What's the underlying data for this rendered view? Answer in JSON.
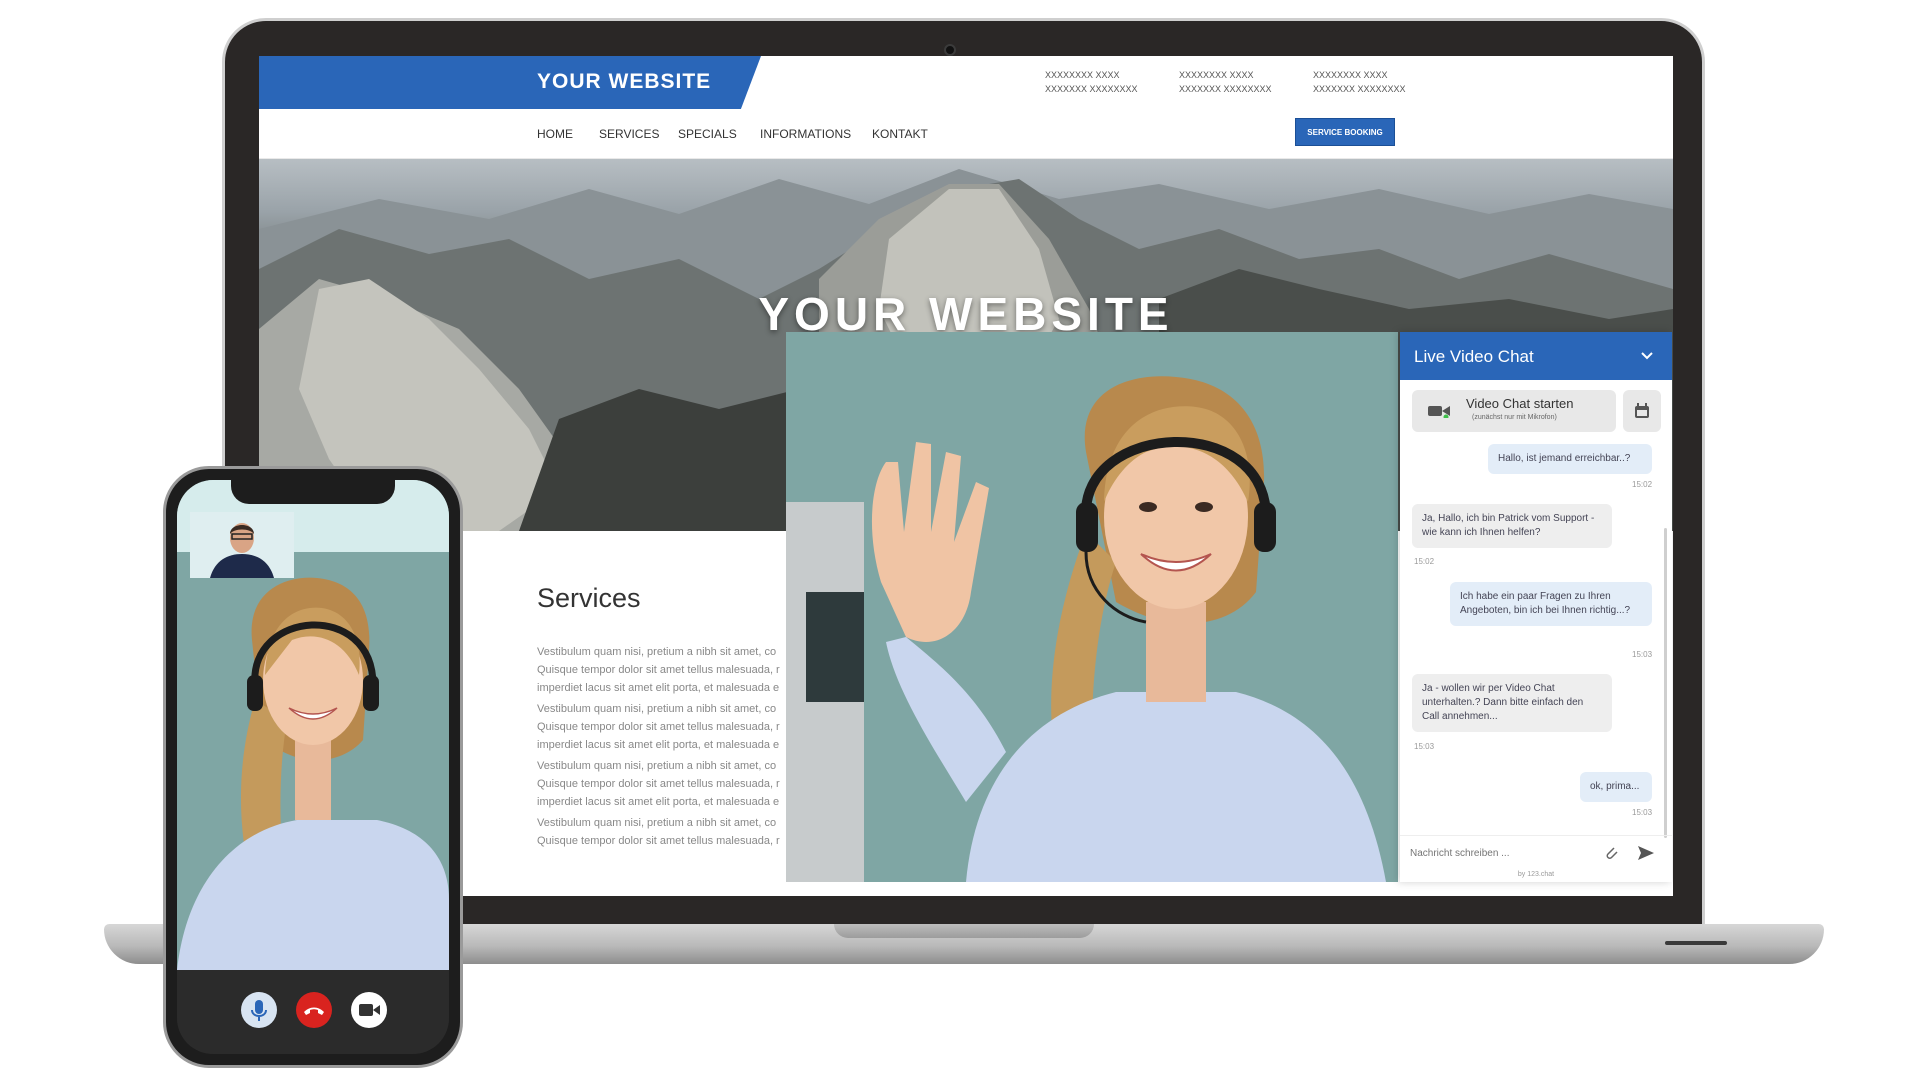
{
  "site": {
    "logo": "YOUR WEBSITE",
    "contacts": [
      {
        "line1": "XXXXXXXX XXXX",
        "line2": "XXXXXXX XXXXXXXX"
      },
      {
        "line1": "XXXXXXXX XXXX",
        "line2": "XXXXXXX XXXXXXXX"
      },
      {
        "line1": "XXXXXXXX XXXX",
        "line2": "XXXXXXX XXXXXXXX"
      }
    ],
    "nav": [
      "HOME",
      "SERVICES",
      "SPECIALS",
      "INFORMATIONS",
      "KONTAKT"
    ],
    "booking_button": "SERVICE BOOKING",
    "hero_title": "YOUR WEBSITE",
    "services_title": "Services",
    "paragraphs": [
      [
        "Vestibulum quam nisi, pretium a nibh sit amet, co",
        "Quisque tempor dolor sit amet tellus malesuada, r",
        "imperdiet lacus sit amet elit porta, et malesuada e"
      ],
      [
        "Vestibulum quam nisi, pretium a nibh sit amet, co",
        "Quisque tempor dolor sit amet tellus malesuada, r",
        "imperdiet lacus sit amet elit porta, et malesuada e"
      ],
      [
        "Vestibulum quam nisi, pretium a nibh sit amet, co",
        "Quisque tempor dolor sit amet tellus malesuada, r",
        "imperdiet lacus sit amet elit porta, et malesuada e"
      ],
      [
        "Vestibulum quam nisi, pretium a nibh sit amet, co",
        "Quisque tempor dolor sit amet tellus malesuada, r"
      ]
    ]
  },
  "chat": {
    "title": "Live Video Chat",
    "start_label": "Video Chat starten",
    "start_sub": "(zunächst nur mit Mikrofon)",
    "messages": [
      {
        "dir": "out",
        "text": "Hallo, ist jemand erreichbar..?",
        "time": "15:02"
      },
      {
        "dir": "in",
        "text": "Ja, Hallo, ich bin Patrick vom Support - wie kann ich Ihnen helfen?",
        "time": "15:02"
      },
      {
        "dir": "out",
        "text": "Ich habe ein paar Fragen zu Ihren Angeboten, bin ich bei Ihnen richtig...?",
        "time": "15:03"
      },
      {
        "dir": "in",
        "text": "Ja - wollen wir per Video Chat unterhalten.? Dann bitte einfach den Call annehmen...",
        "time": "15:03"
      },
      {
        "dir": "out",
        "text": "ok, prima...",
        "time": "15:03"
      }
    ],
    "input_placeholder": "Nachricht schreiben ...",
    "powered_by": "by 123.chat"
  },
  "colors": {
    "brand_blue": "#2a66b8",
    "hangup_red": "#d9231f",
    "online_green": "#3fbf4a"
  },
  "icons": [
    "camera-icon",
    "calendar-icon",
    "chevron-down-icon",
    "paperclip-icon",
    "send-icon",
    "microphone-icon",
    "phone-hangup-icon",
    "video-camera-icon"
  ]
}
